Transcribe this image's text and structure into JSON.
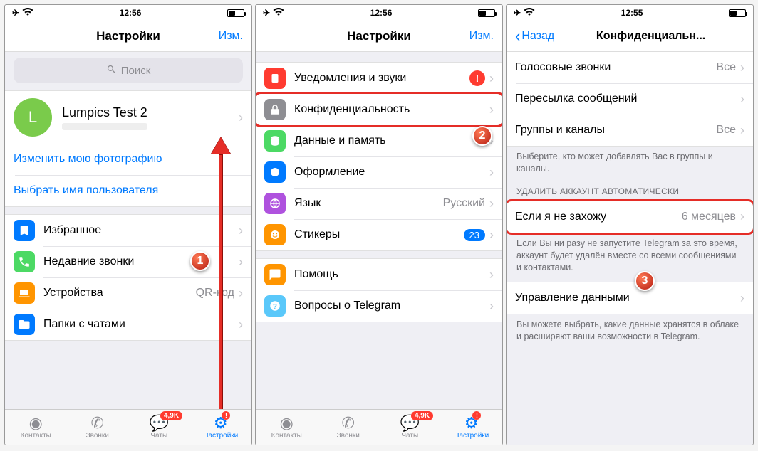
{
  "statusbar": {
    "time1": "12:56",
    "time2": "12:56",
    "time3": "12:55"
  },
  "nav": {
    "settings_title": "Настройки",
    "edit": "Изм.",
    "back": "Назад",
    "privacy_title": "Конфиденциальн..."
  },
  "search": {
    "placeholder": "Поиск"
  },
  "profile": {
    "initial": "L",
    "name": "Lumpics Test 2"
  },
  "links": {
    "change_photo": "Изменить мою фотографию",
    "choose_username": "Выбрать имя пользователя"
  },
  "s1": {
    "saved": "Избранное",
    "recent_calls": "Недавние звонки",
    "devices": "Устройства",
    "devices_val": "QR-код",
    "folders": "Папки с чатами"
  },
  "s2": {
    "notifications": "Уведомления и звуки",
    "privacy": "Конфиденциальность",
    "data": "Данные и память",
    "appearance": "Оформление",
    "language": "Язык",
    "language_val": "Русский",
    "stickers": "Стикеры",
    "stickers_badge": "23",
    "help": "Помощь",
    "faq": "Вопросы о Telegram"
  },
  "s3": {
    "voice_calls": "Голосовые звонки",
    "voice_calls_val": "Все",
    "forwarding": "Пересылка сообщений",
    "groups": "Группы и каналы",
    "groups_val": "Все",
    "groups_footer": "Выберите, кто может добавлять Вас в группы и каналы.",
    "delete_header": "УДАЛИТЬ АККАУНТ АВТОМАТИЧЕСКИ",
    "if_away": "Если я не захожу",
    "if_away_val": "6 месяцев",
    "delete_footer": "Если Вы ни разу не запустите Telegram за это время, аккаунт будет удалён вместе со всеми сообщениями и контактами.",
    "data_mgmt": "Управление данными",
    "data_mgmt_footer": "Вы можете выбрать, какие данные хранятся в облаке и расширяют ваши возможности в Telegram."
  },
  "tabs": {
    "contacts": "Контакты",
    "calls": "Звонки",
    "chats": "Чаты",
    "chats_badge": "4,9K",
    "settings": "Настройки",
    "settings_alert": "!"
  },
  "steps": {
    "one": "1",
    "two": "2",
    "three": "3"
  }
}
